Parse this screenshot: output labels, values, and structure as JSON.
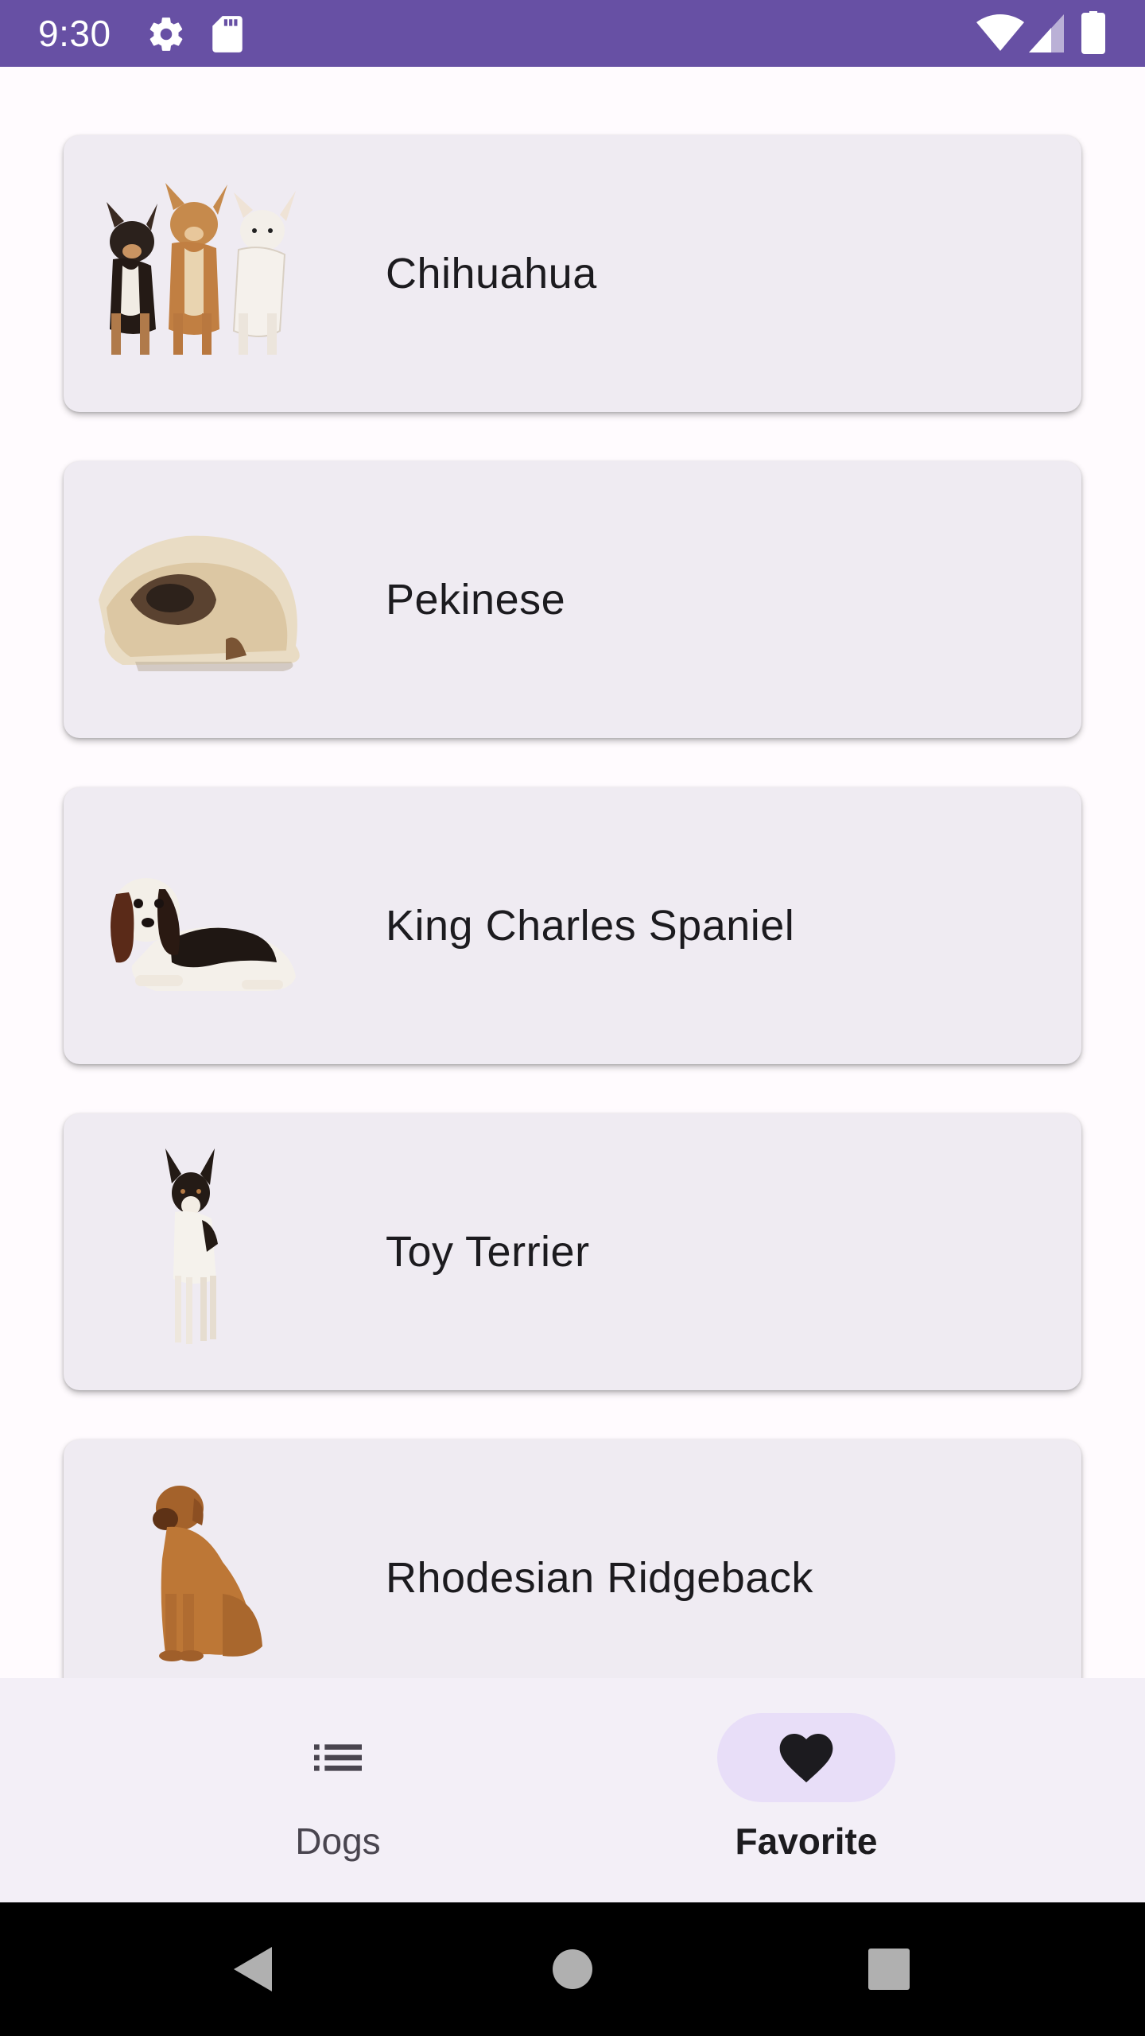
{
  "status_bar": {
    "time": "9:30",
    "left_icons": [
      "settings-icon",
      "sd-card-icon"
    ],
    "right_icons": [
      "wifi-icon",
      "cell-signal-icon",
      "battery-icon"
    ],
    "background_color": "#6750a4"
  },
  "dogs": [
    {
      "name": "Chihuahua"
    },
    {
      "name": "Pekinese"
    },
    {
      "name": "King Charles Spaniel"
    },
    {
      "name": "Toy Terrier"
    },
    {
      "name": "Rhodesian Ridgeback"
    }
  ],
  "bottom_nav": {
    "items": [
      {
        "label": "Dogs",
        "icon": "list-icon",
        "selected": false
      },
      {
        "label": "Favorite",
        "icon": "heart-icon",
        "selected": true
      }
    ],
    "active_indicator_color": "#e8def8"
  },
  "system_nav": {
    "buttons": [
      "back-icon",
      "home-icon",
      "recents-icon"
    ]
  }
}
